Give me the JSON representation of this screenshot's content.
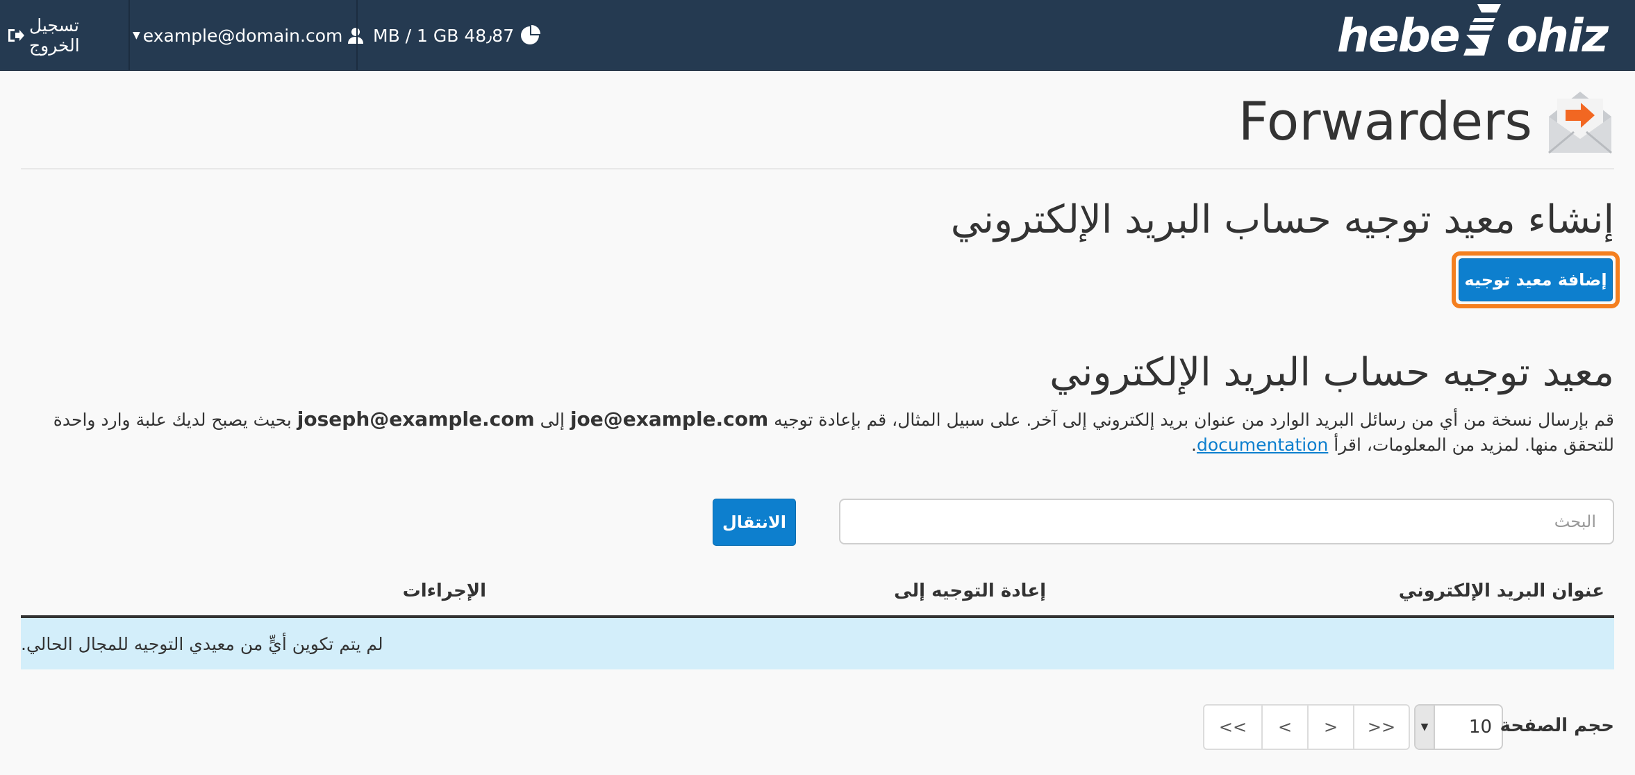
{
  "topbar": {
    "logout_label": "تسجيل الخروج",
    "user_email": "example@domain.com",
    "disk_usage": "MB / 1 GB 48٫87",
    "logo_text_left": "hebe",
    "logo_text_right": "ohiz"
  },
  "page": {
    "title": "Forwarders"
  },
  "create": {
    "heading": "إنشاء معيد توجيه حساب البريد الإلكتروني",
    "add_button": "إضافة معيد توجيه"
  },
  "list": {
    "heading": "معيد توجيه حساب البريد الإلكتروني",
    "desc_part1": "قم بإرسال نسخة من أي من رسائل البريد الوارد من عنوان بريد إلكتروني إلى آخر. على سبيل المثال، قم بإعادة توجيه ",
    "desc_email1": "joe@example.com",
    "desc_part2": " إلى ",
    "desc_email2": "joseph@example.com",
    "desc_part3": " بحيث يصبح لديك علبة وارد واحدة للتحقق منها. لمزيد من المعلومات، اقرأ ",
    "desc_link": "documentation",
    "desc_end": "."
  },
  "search": {
    "placeholder": "البحث",
    "go_button": "الانتقال"
  },
  "table": {
    "col_email": "عنوان البريد الإلكتروني",
    "col_forward": "إعادة التوجيه إلى",
    "col_actions": "الإجراءات",
    "empty_message": "لم يتم تكوين أيٍّ من معيدي التوجيه للمجال الحالي."
  },
  "pagination": {
    "first": "<<",
    "prev": "<",
    "next": ">",
    "last": ">>",
    "page_size_label": "حجم الصفحة",
    "page_size_value": "10"
  },
  "colors": {
    "topbar": "#253a51",
    "primary": "#0d7fce",
    "highlight": "#f47f1f",
    "empty_row": "#d3eefa"
  }
}
